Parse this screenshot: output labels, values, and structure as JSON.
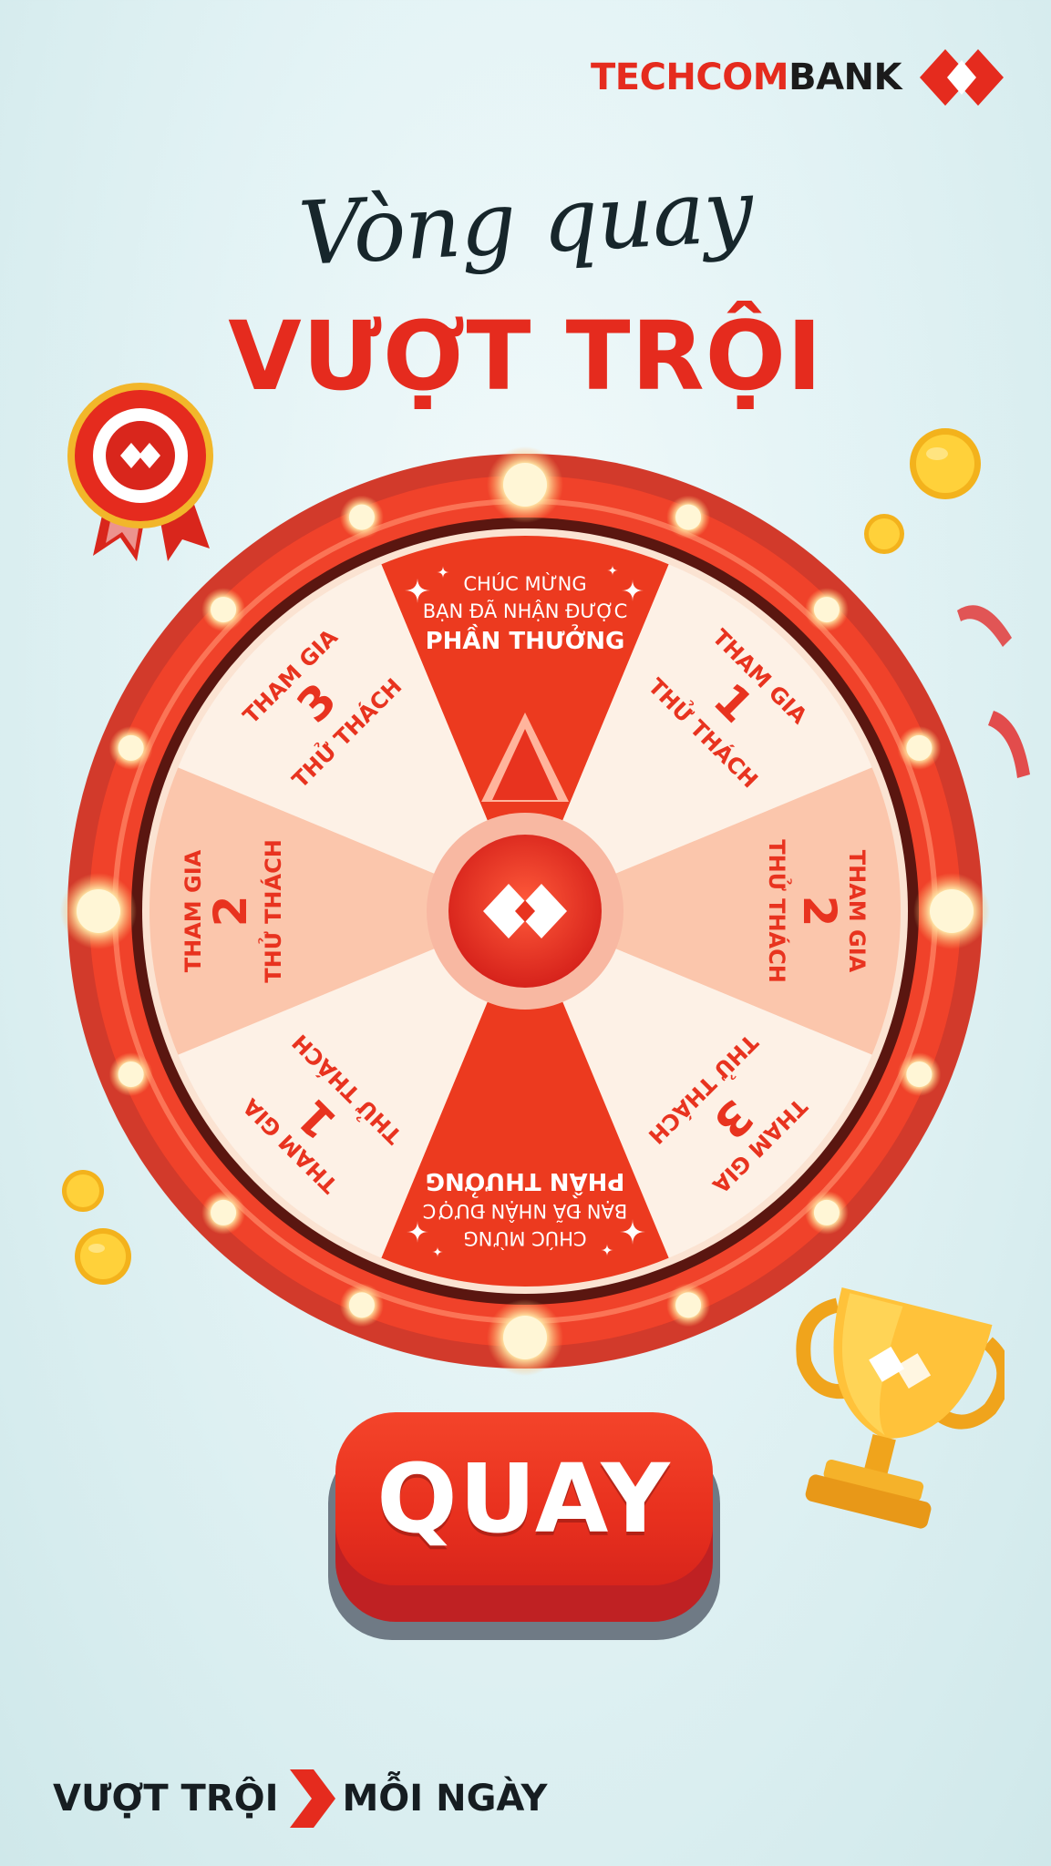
{
  "brand": {
    "name_part1": "TECHCOM",
    "name_part2": "BANK",
    "logo_icon": "diamond-logo-icon",
    "red": "#e52b1e"
  },
  "title": {
    "script": "Vòng quay",
    "main": "VƯỢT TRỘI"
  },
  "wheel": {
    "segments": [
      {
        "line1": "CHÚC MỪNG",
        "line2": "BẠN ĐÃ NHẬN ĐƯỢC",
        "line3": "PHẦN THƯỞNG",
        "style": "red"
      },
      {
        "line1": "THAM GIA",
        "number": "1",
        "line3": "THỬ THÁCH",
        "style": "cream"
      },
      {
        "line1": "THAM GIA",
        "number": "2",
        "line3": "THỬ THÁCH",
        "style": "peach"
      },
      {
        "line1": "THAM GIA",
        "number": "3",
        "line3": "THỬ THÁCH",
        "style": "cream"
      },
      {
        "line1": "CHÚC MỪNG",
        "line2": "BẠN ĐÃ NHẬN ĐƯỢC",
        "line3": "PHẦN THƯỞNG",
        "style": "red"
      },
      {
        "line1": "THAM GIA",
        "number": "1",
        "line3": "THỬ THÁCH",
        "style": "cream"
      },
      {
        "line1": "THAM GIA",
        "number": "2",
        "line3": "THỬ THÁCH",
        "style": "peach"
      },
      {
        "line1": "THAM GIA",
        "number": "3",
        "line3": "THỬ THÁCH",
        "style": "cream"
      }
    ],
    "colors": {
      "red": "#ec3a1f",
      "cream": "#fdf1e6",
      "peach": "#fbc6ac",
      "text": "#e8331f"
    }
  },
  "spin_button": {
    "label": "QUAY"
  },
  "footer": {
    "slogan_left": "VƯỢT TRỘI",
    "slogan_right": "MỖI NGÀY",
    "arrow_icon": "chevron-right-icon"
  },
  "decorations": [
    "ribbon-badge-icon",
    "gold-coin-icon",
    "trophy-icon",
    "confetti-icon"
  ]
}
